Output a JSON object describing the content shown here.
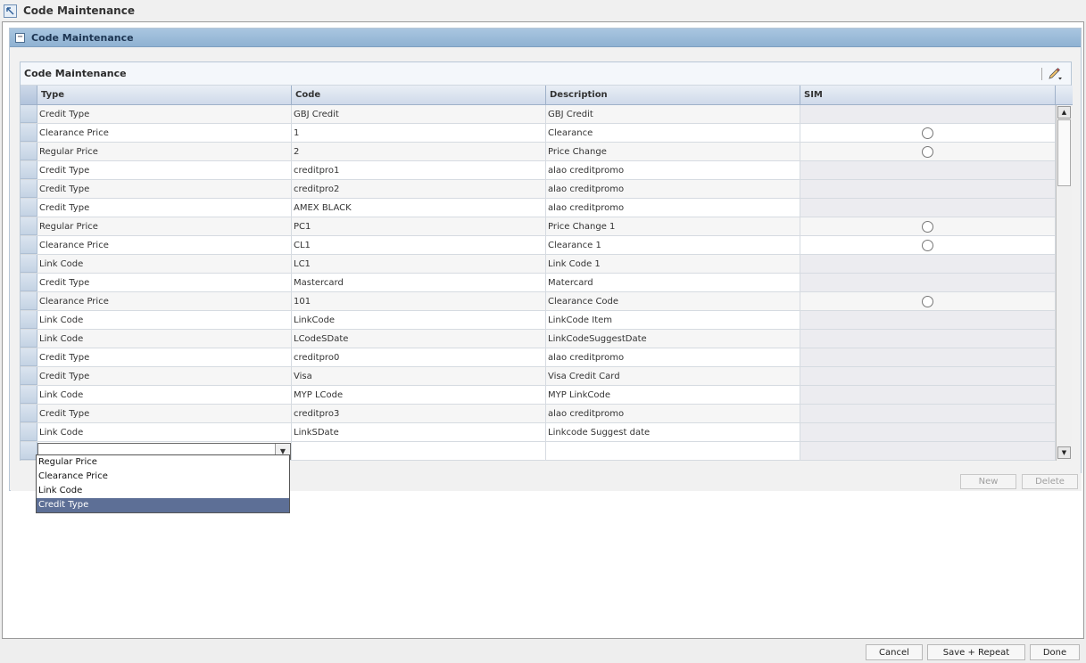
{
  "window": {
    "title": "Code Maintenance"
  },
  "section": {
    "title": "Code Maintenance",
    "collapse_symbol": "−"
  },
  "table": {
    "title": "Code Maintenance",
    "columns": [
      "Type",
      "Code",
      "Description",
      "SIM"
    ],
    "rows": [
      {
        "type": "Credit Type",
        "code": "GBJ Credit",
        "description": "GBJ Credit",
        "sim": "disabled"
      },
      {
        "type": "Clearance Price",
        "code": "1",
        "description": "Clearance",
        "sim": "radio"
      },
      {
        "type": "Regular Price",
        "code": "2",
        "description": "Price Change",
        "sim": "radio"
      },
      {
        "type": "Credit Type",
        "code": "creditpro1",
        "description": "alao creditpromo",
        "sim": "disabled"
      },
      {
        "type": "Credit Type",
        "code": "creditpro2",
        "description": "alao creditpromo",
        "sim": "disabled"
      },
      {
        "type": "Credit Type",
        "code": "AMEX BLACK",
        "description": "alao creditpromo",
        "sim": "disabled"
      },
      {
        "type": "Regular Price",
        "code": "PC1",
        "description": "Price Change 1",
        "sim": "radio"
      },
      {
        "type": "Clearance Price",
        "code": "CL1",
        "description": "Clearance 1",
        "sim": "radio"
      },
      {
        "type": "Link Code",
        "code": "LC1",
        "description": "Link Code 1",
        "sim": "disabled"
      },
      {
        "type": "Credit Type",
        "code": "Mastercard",
        "description": "Matercard",
        "sim": "disabled"
      },
      {
        "type": "Clearance Price",
        "code": "101",
        "description": "Clearance Code",
        "sim": "radio"
      },
      {
        "type": "Link Code",
        "code": "LinkCode",
        "description": "LinkCode Item",
        "sim": "disabled"
      },
      {
        "type": "Link Code",
        "code": "LCodeSDate",
        "description": "LinkCodeSuggestDate",
        "sim": "disabled"
      },
      {
        "type": "Credit Type",
        "code": "creditpro0",
        "description": "alao creditpromo",
        "sim": "disabled"
      },
      {
        "type": "Credit Type",
        "code": "Visa",
        "description": "Visa Credit Card",
        "sim": "disabled"
      },
      {
        "type": "Link Code",
        "code": "MYP LCode",
        "description": "MYP LinkCode",
        "sim": "disabled"
      },
      {
        "type": "Credit Type",
        "code": "creditpro3",
        "description": "alao creditpromo",
        "sim": "disabled"
      },
      {
        "type": "Link Code",
        "code": "LinkSDate",
        "description": "Linkcode Suggest date",
        "sim": "disabled"
      }
    ],
    "new_row": {
      "type": "",
      "code": "",
      "description": ""
    }
  },
  "dropdown": {
    "options": [
      "Regular Price",
      "Clearance Price",
      "Link Code",
      "Credit Type"
    ],
    "selected_index": 3
  },
  "actions": {
    "new_label": "New",
    "delete_label": "Delete"
  },
  "footer": {
    "cancel_label": "Cancel",
    "save_repeat_label": "Save + Repeat",
    "done_label": "Done"
  },
  "icons": {
    "window": "restore-arrow-icon",
    "collapse": "minus-box-icon",
    "edit": "pencil-dropdown-icon",
    "scroll_up": "arrow-up-icon",
    "scroll_down": "arrow-down-icon",
    "select": "chevron-down-icon"
  },
  "colors": {
    "section_header": "#8fb2d2",
    "selected_option": "#5d6f96"
  }
}
